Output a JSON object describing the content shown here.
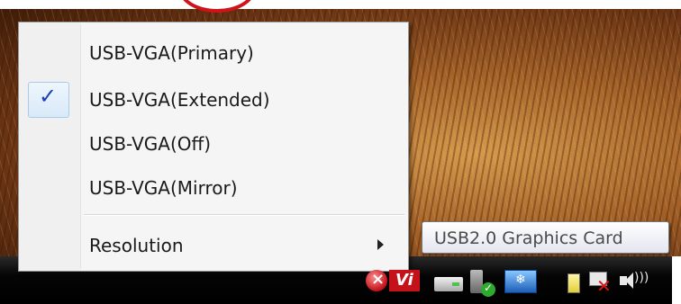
{
  "menu": {
    "items": [
      {
        "label": "USB-VGA(Primary)",
        "checked": false
      },
      {
        "label": "USB-VGA(Extended)",
        "checked": true
      },
      {
        "label": "USB-VGA(Off)",
        "checked": false
      },
      {
        "label": "USB-VGA(Mirror)",
        "checked": false
      }
    ],
    "resolution_label": "Resolution",
    "check_glyph": "✓"
  },
  "tooltip": {
    "text": "USB2.0 Graphics Card"
  },
  "tray": {
    "icons": [
      "antivirus-shield-icon",
      "vi-icon",
      "removable-drive-icon",
      "usb-device-icon",
      "graphics-card-icon",
      "power-icon",
      "network-icon",
      "volume-icon"
    ]
  },
  "colors": {
    "annotation_circle": "#d0121b",
    "check": "#1b3fb5"
  }
}
